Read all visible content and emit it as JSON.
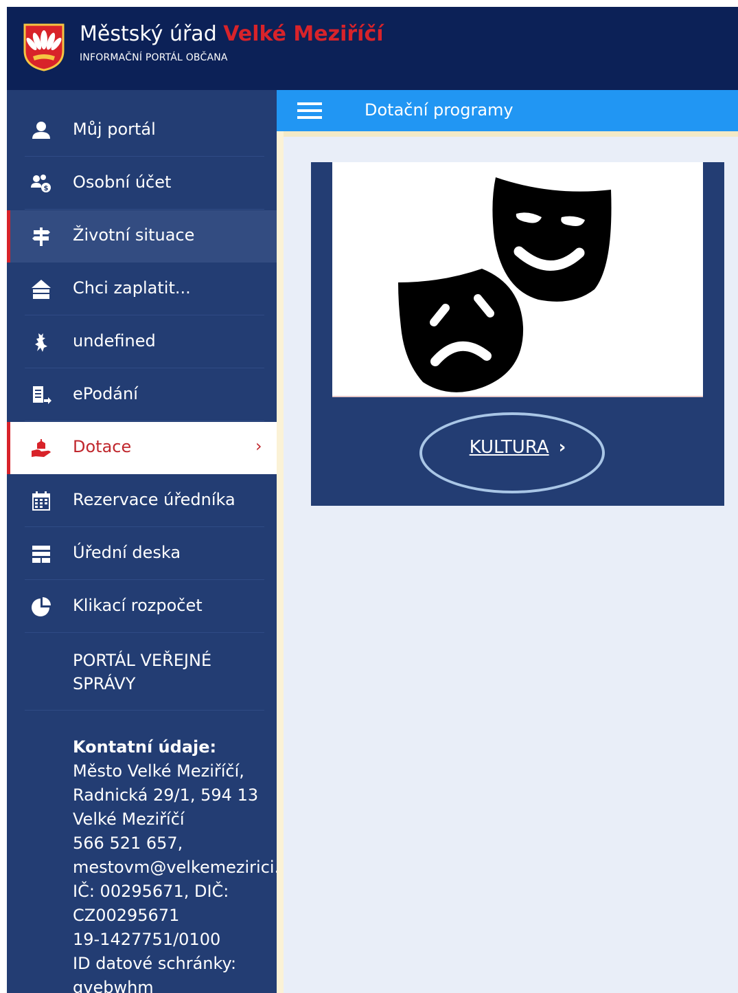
{
  "header": {
    "title_main": "Městský úřad",
    "title_accent": "Velké Meziříčí",
    "subtitle": "INFORMAČNÍ PORTÁL OBČANA",
    "logo_icon": "coat-of-arms-icon"
  },
  "topbar": {
    "title": "Dotační programy",
    "menu_icon": "hamburger-menu-icon"
  },
  "sidebar": {
    "items": [
      {
        "label": "Můj portál",
        "icon": "user-icon"
      },
      {
        "label": "Osobní účet",
        "icon": "users-account-icon"
      },
      {
        "label": "Životní situace",
        "icon": "signpost-icon",
        "state": "hover"
      },
      {
        "label": "Chci zaplatit...",
        "icon": "payment-tray-icon"
      },
      {
        "label": "undefined",
        "icon": "lion-emblem-icon"
      },
      {
        "label": "ePodání",
        "icon": "document-send-icon"
      },
      {
        "label": "Dotace",
        "icon": "money-hand-icon",
        "state": "active"
      },
      {
        "label": "Rezervace úředníka",
        "icon": "calendar-icon"
      },
      {
        "label": "Úřední deska",
        "icon": "board-icon"
      },
      {
        "label": "Klikací rozpočet",
        "icon": "pie-chart-icon"
      }
    ],
    "portal_line1": "PORTÁL VEŘEJNÉ",
    "portal_line2": "SPRÁVY",
    "contact": {
      "title": "Kontatní údaje:",
      "lines": [
        "Město Velké Meziříčí,",
        "Radnická 29/1, 594 13",
        "Velké Meziříčí",
        "566 521 657,",
        "mestovm@velkemezirici.cz",
        "IČ: 00295671, DIČ:",
        "CZ00295671",
        "19-1427751/0100",
        "ID datové schránky:",
        "gvebwhm"
      ]
    }
  },
  "card": {
    "image_icon": "theatre-masks-icon",
    "link_label": "KULTURA",
    "link_chevron": "›"
  },
  "colors": {
    "header_bg": "#0c2157",
    "sidebar_bg": "#233d73",
    "topbar_bg": "#2196f3",
    "accent_red": "#d8232a",
    "content_bg": "#e9eef8"
  }
}
